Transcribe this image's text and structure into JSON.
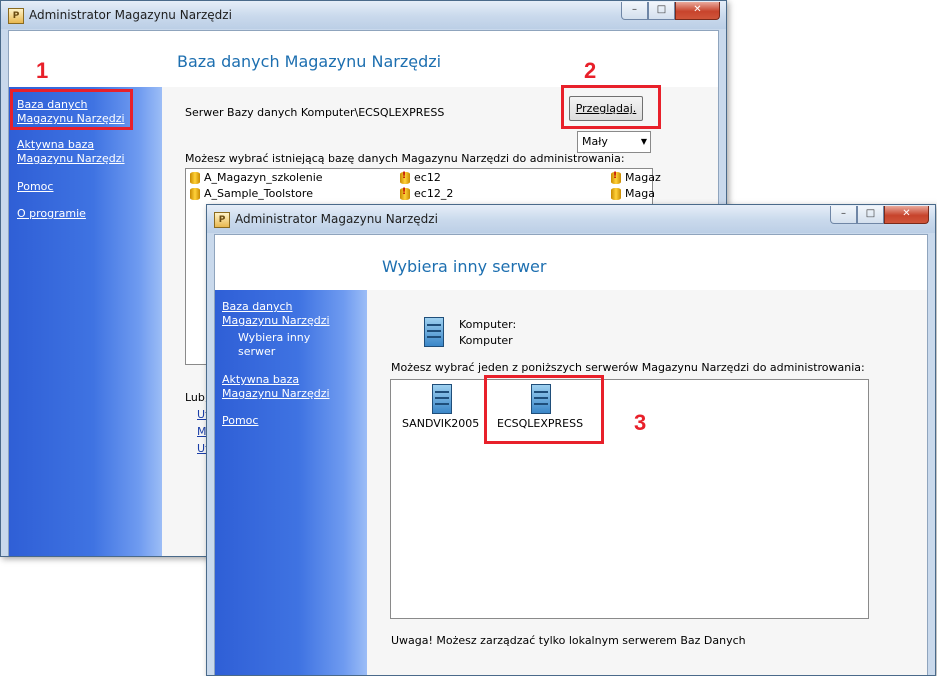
{
  "window1": {
    "title": "Administrator Magazynu Narzędzi",
    "header": "Baza danych Magazynu Narzędzi",
    "sidebar": [
      {
        "label": "Baza danych Magazynu Narzędzi"
      },
      {
        "label": "Aktywna baza Magazynu Narzędzi"
      },
      {
        "label": "Pomoc"
      },
      {
        "label": "O programie"
      }
    ],
    "server_label": "Serwer Bazy danych Komputer\\ECSQLEXPRESS",
    "browse_button": "Przeglądaj.",
    "size_select": "Mały",
    "list_label": "Możesz wybrać istniejącą bazę danych Magazynu Narzędzi do administrowania:",
    "databases_col1": [
      "A_Magazyn_szkolenie",
      "A_Sample_Toolstore"
    ],
    "databases_col2": [
      "ec12",
      "ec12_2"
    ],
    "databases_col3": [
      "Magaz",
      "Maga"
    ],
    "or_label": "Lub,",
    "link_fragments": [
      "Ut",
      "M",
      "Ut"
    ]
  },
  "window2": {
    "title": "Administrator Magazynu Narzędzi",
    "header": "Wybiera inny serwer",
    "sidebar": [
      {
        "label": "Baza danych Magazynu Narzędzi"
      },
      {
        "label": "Wybiera inny serwer"
      },
      {
        "label": "Aktywna baza Magazynu Narzędzi"
      },
      {
        "label": "Pomoc"
      }
    ],
    "computer_label": "Komputer:",
    "computer_value": "Komputer",
    "servers_label": "Możesz wybrać jeden z poniższych serwerów Magazynu Narzędzi do administrowania:",
    "servers": [
      "SANDVIK2005",
      "ECSQLEXPRESS"
    ],
    "warning": "Uwaga! Możesz zarządzać tylko lokalnym serwerem Baz Danych"
  },
  "annotations": [
    "1",
    "2",
    "3"
  ],
  "colors": {
    "annotation": "#e8202a",
    "header_text": "#1d6fb0",
    "sidebar": "#3f73e2"
  }
}
